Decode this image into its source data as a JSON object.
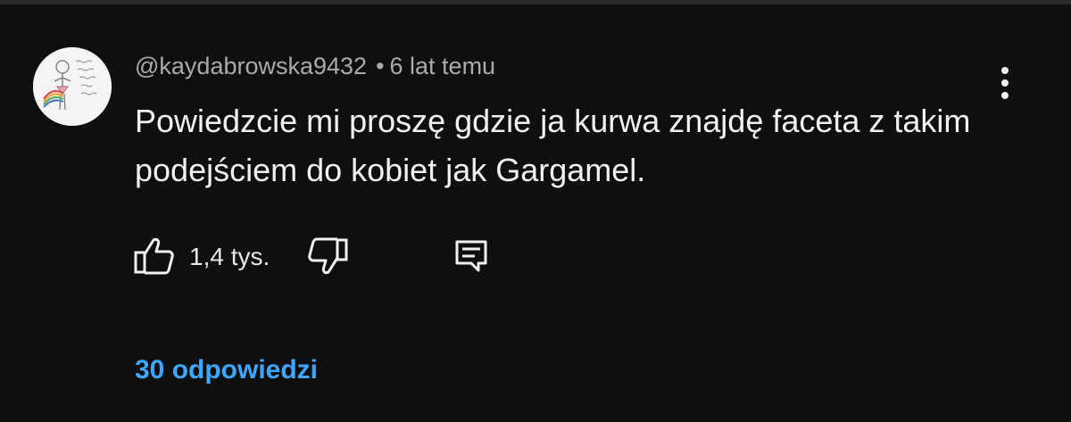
{
  "comment": {
    "author": "@kaydabrowska9432",
    "separator": "•",
    "timestamp": "6 lat temu",
    "text": "Powiedzcie mi proszę gdzie ja kurwa znajdę faceta z takim podejściem do kobiet jak Gargamel.",
    "like_count": "1,4 tys.",
    "replies_label": "30 odpowiedzi"
  },
  "icons": {
    "menu": "more-vertical-icon",
    "like": "thumbs-up-icon",
    "dislike": "thumbs-down-icon",
    "reply": "reply-comment-icon"
  },
  "colors": {
    "background": "#0f0f0f",
    "text_primary": "#f1f1f1",
    "text_secondary": "#aaaaaa",
    "link": "#3ea6ff"
  }
}
